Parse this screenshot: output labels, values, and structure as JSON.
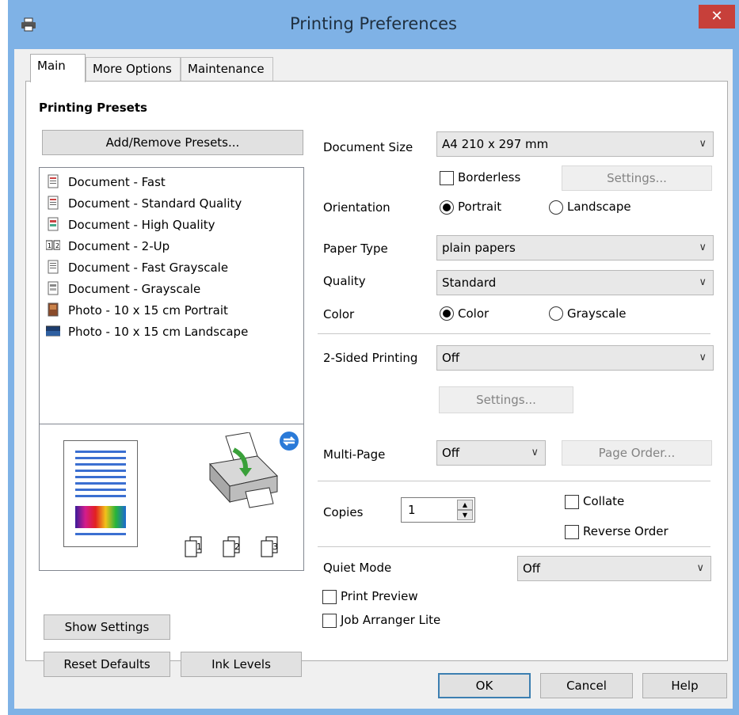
{
  "window": {
    "title": "Printing Preferences",
    "close_glyph": "✕",
    "accent": "#7fb2e6",
    "close_color": "#c7403a"
  },
  "tabs": [
    {
      "label": "Main"
    },
    {
      "label": "More Options"
    },
    {
      "label": "Maintenance"
    }
  ],
  "presets": {
    "heading": "Printing Presets",
    "add_remove_label": "Add/Remove Presets...",
    "items": [
      {
        "label": "Document - Fast",
        "icon": "document-fast-icon"
      },
      {
        "label": "Document - Standard Quality",
        "icon": "document-standard-icon"
      },
      {
        "label": "Document - High Quality",
        "icon": "document-high-quality-icon"
      },
      {
        "label": "Document - 2-Up",
        "icon": "two-up-icon"
      },
      {
        "label": "Document - Fast Grayscale",
        "icon": "document-grayscale-fast-icon"
      },
      {
        "label": "Document - Grayscale",
        "icon": "document-grayscale-icon"
      },
      {
        "label": "Photo - 10 x 15 cm Portrait",
        "icon": "photo-portrait-icon"
      },
      {
        "label": "Photo - 10 x 15 cm Landscape",
        "icon": "photo-landscape-icon"
      }
    ],
    "page_labels": [
      "1",
      "2",
      "3"
    ]
  },
  "settings": {
    "document_size_label": "Document Size",
    "document_size_value": "A4 210 x 297 mm",
    "borderless_label": "Borderless",
    "settings_button": "Settings...",
    "orientation_label": "Orientation",
    "portrait_label": "Portrait",
    "landscape_label": "Landscape",
    "paper_type_label": "Paper Type",
    "paper_type_value": "plain papers",
    "quality_label": "Quality",
    "quality_value": "Standard",
    "color_label": "Color",
    "color_option": "Color",
    "grayscale_option": "Grayscale",
    "two_sided_label": "2-Sided Printing",
    "two_sided_value": "Off",
    "two_sided_settings": "Settings...",
    "multipage_label": "Multi-Page",
    "multipage_value": "Off",
    "page_order_label": "Page Order...",
    "copies_label": "Copies",
    "copies_value": "1",
    "collate_label": "Collate",
    "reverse_order_label": "Reverse Order",
    "quiet_mode_label": "Quiet Mode",
    "quiet_mode_value": "Off",
    "print_preview_label": "Print Preview",
    "job_arranger_label": "Job Arranger Lite"
  },
  "left_buttons": {
    "show_settings": "Show Settings",
    "reset_defaults": "Reset Defaults",
    "ink_levels": "Ink Levels"
  },
  "footer": {
    "ok": "OK",
    "cancel": "Cancel",
    "help": "Help"
  }
}
